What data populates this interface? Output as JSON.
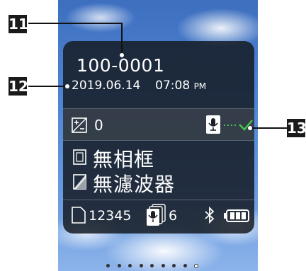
{
  "callouts": {
    "c11": "11",
    "c12": "12",
    "c13": "13"
  },
  "info": {
    "file_number": "100-0001",
    "date": "2019.06.14",
    "time": "07:08",
    "ampm": "PM"
  },
  "exposure": {
    "value": "0",
    "icon": "exposure-compensation-icon"
  },
  "settings": {
    "frame": "無相框",
    "filter": "無濾波器"
  },
  "status": {
    "remaining_shots": "12345",
    "voice_memo_count": "6"
  },
  "page_indicator": {
    "count": 9,
    "active_index": 8
  }
}
